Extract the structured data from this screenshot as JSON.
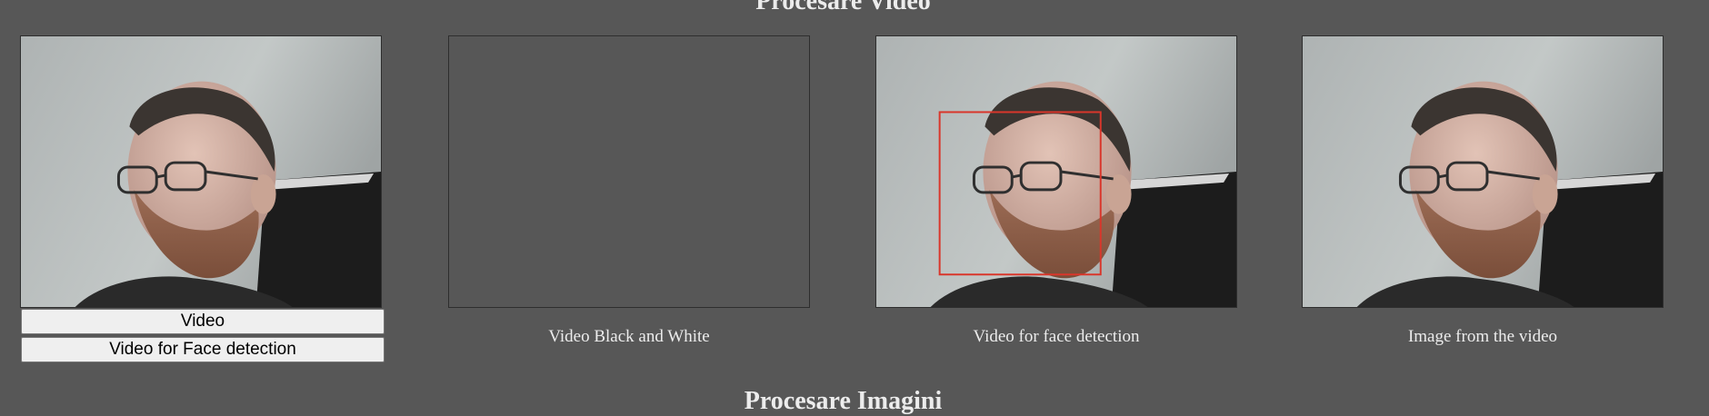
{
  "sections": {
    "video_title": "Procesare Video",
    "images_title": "Procesare Imagini"
  },
  "buttons": {
    "video": "Video",
    "face_detection": "Video for Face detection"
  },
  "captions": {
    "black_white": "Video Black and White",
    "face_detection": "Video for face detection",
    "image_from_video": "Image from the video"
  },
  "colors": {
    "page_background": "#575757",
    "text": "#ececec",
    "detection_box": "#d9362b"
  }
}
